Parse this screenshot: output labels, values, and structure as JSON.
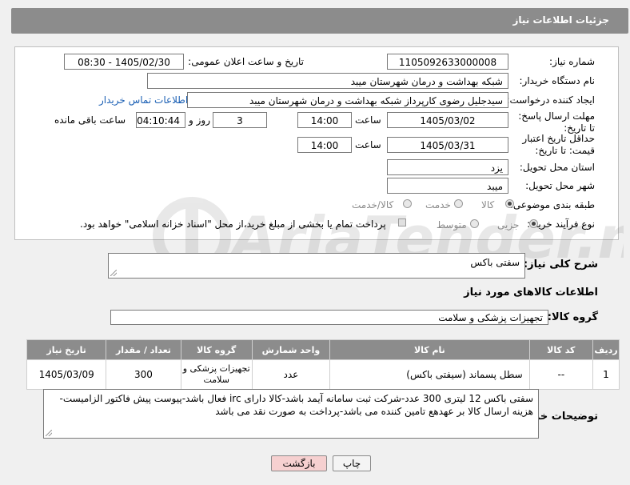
{
  "header": {
    "title": "جزئیات اطلاعات نیاز"
  },
  "fields": {
    "need_number_label": "شماره نیاز:",
    "need_number": "1105092633000008",
    "announce_label": "تاریخ و ساعت اعلان عمومی:",
    "announce_value": "1405/02/30 - 08:30",
    "buyer_label": "نام دستگاه خریدار:",
    "buyer_value": "شبکه بهداشت و درمان شهرستان میبد",
    "creator_label": "ایجاد کننده درخواست:",
    "creator_value": "سیدجلیل رضوی کارپرداز شبکه بهداشت و درمان شهرستان میبد",
    "contact_link": "اطلاعات تماس خریدار",
    "deadline_label": "مهلت ارسال پاسخ: تا تاریخ:",
    "deadline_date": "1405/03/02",
    "time_label": "ساعت",
    "deadline_time": "14:00",
    "days_value": "3",
    "days_label": "روز و",
    "remain_time": "04:10:44",
    "remain_label": "ساعت باقی مانده",
    "validity_label": "حداقل تاریخ اعتبار قیمت: تا تاریخ:",
    "validity_date": "1405/03/31",
    "validity_time": "14:00",
    "province_label": "استان محل تحویل:",
    "province_value": "یزد",
    "city_label": "شهر محل تحویل:",
    "city_value": "میبد",
    "category_label": "طبقه بندی موضوعی:",
    "cat_goods": "کالا",
    "cat_service": "خدمت",
    "cat_both": "کالا/خدمت",
    "process_label": "نوع فرآیند خرید :",
    "proc_small": "جزیی",
    "proc_medium": "متوسط",
    "payment_note": "پرداخت تمام یا بخشی از مبلغ خرید،از محل \"اسناد خزانه اسلامی\" خواهد بود."
  },
  "summary": {
    "label": "شرح کلی نیاز:",
    "value": "سفتی باکس"
  },
  "goods_info_title": "اطلاعات کالاهای مورد نیاز",
  "goods_group": {
    "label": "گروه کالا:",
    "value": "تجهیزات پزشکی و سلامت"
  },
  "table": {
    "headers": [
      "ردیف",
      "کد کالا",
      "نام کالا",
      "واحد شمارش",
      "گروه کالا",
      "تعداد / مقدار",
      "تاریخ نیاز"
    ],
    "rows": [
      [
        "1",
        "--",
        "سطل پسماند (سیفتی باکس)",
        "عدد",
        "تجهیزات پزشکی و سلامت",
        "300",
        "1405/03/09"
      ]
    ]
  },
  "notes": {
    "label": "توضیحات خریدار:",
    "value": "سفتی باکس 12 لیتری 300 عدد-شرکت ثبت سامانه آیمد باشد-کالا دارای irc  فعال باشد-پیوست پیش فاکتور الزامیست-هزینه ارسال کالا بر عهدهع تامین کننده می باشد-پرداخت به صورت نقد می باشد"
  },
  "buttons": {
    "print": "چاپ",
    "back": "بازگشت"
  },
  "watermark": {
    "text": "AriaTender.net"
  },
  "colors": {
    "header_bg": "#8c8c8c",
    "link": "#1a5fb4",
    "back_btn": "#f6d0d0"
  }
}
